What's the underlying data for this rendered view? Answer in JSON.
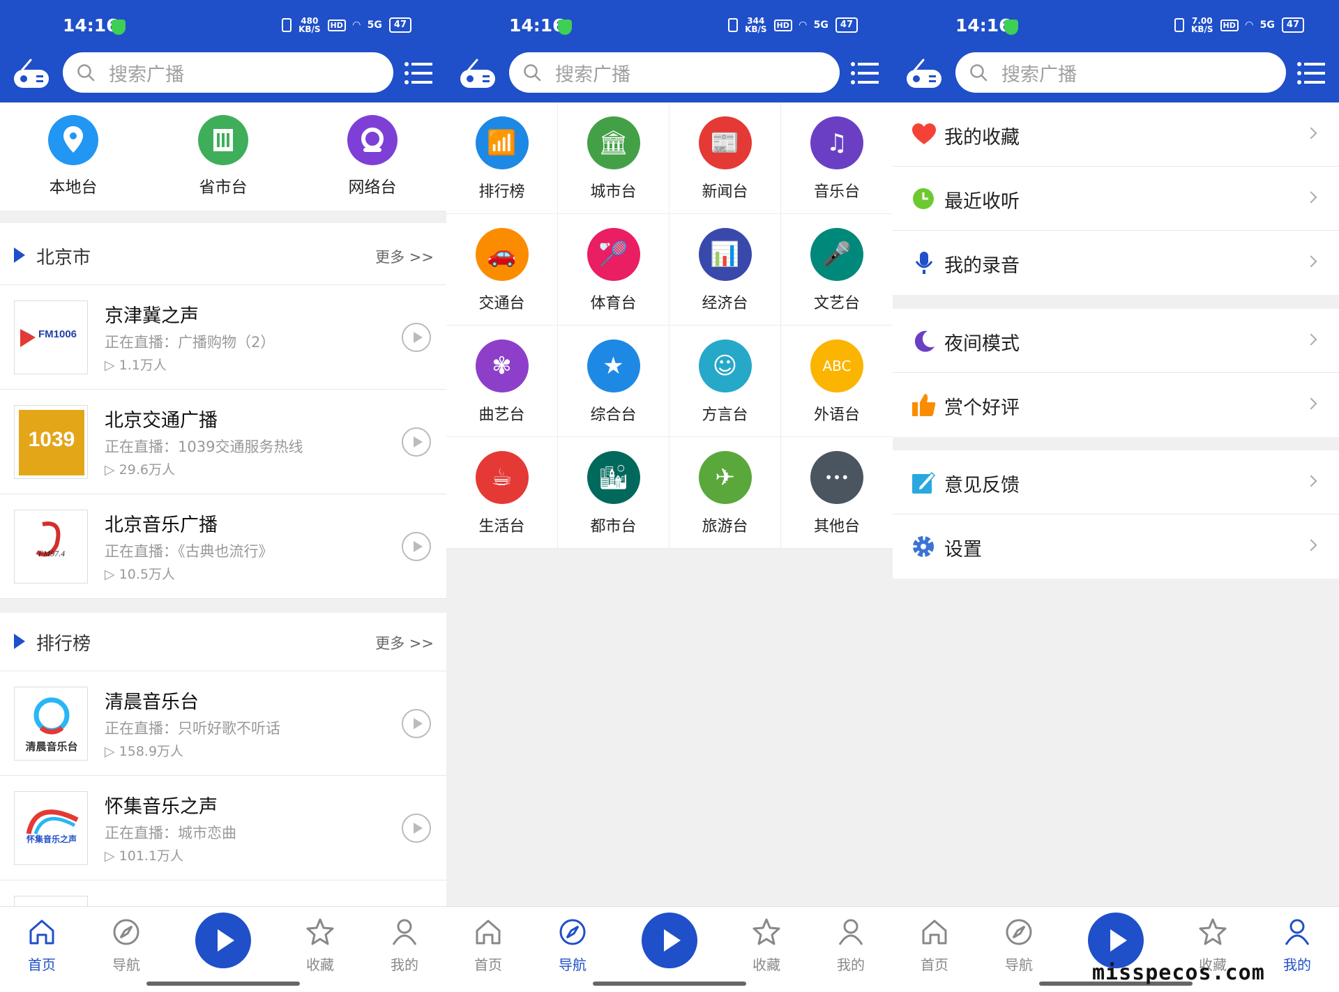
{
  "status": {
    "time": "14:16",
    "speed_1": "480\nKB/S",
    "speed_2": "344\nKB/S",
    "speed_3": "7.00\nKB/S",
    "hd": "HD",
    "network": "5G",
    "battery": "47"
  },
  "search": {
    "placeholder": "搜索广播"
  },
  "home": {
    "quick": [
      {
        "label": "本地台",
        "color": "#2196f3",
        "icon": "location-icon"
      },
      {
        "label": "省市台",
        "color": "#3fae5a",
        "icon": "building-icon"
      },
      {
        "label": "网络台",
        "color": "#7e3fd6",
        "icon": "network-icon"
      }
    ],
    "sections": [
      {
        "title": "北京市",
        "more": "更多 >>",
        "stations": [
          {
            "name": "京津冀之声",
            "live": "正在直播：广播购物（2）",
            "count": "▷ 1.1万人",
            "logo": "FM1006"
          },
          {
            "name": "北京交通广播",
            "live": "正在直播：1039交通服务热线",
            "count": "▷ 29.6万人",
            "logo": "1039"
          },
          {
            "name": "北京音乐广播",
            "live": "正在直播：《古典也流行》",
            "count": "▷ 10.5万人",
            "logo": "FM97.4"
          }
        ]
      },
      {
        "title": "排行榜",
        "more": "更多 >>",
        "stations": [
          {
            "name": "清晨音乐台",
            "live": "正在直播：只听好歌不听话",
            "count": "▷ 158.9万人",
            "logo": "清晨音乐台"
          },
          {
            "name": "怀集音乐之声",
            "live": "正在直播：城市恋曲",
            "count": "▷ 101.1万人",
            "logo": "怀集音乐之声"
          }
        ]
      }
    ]
  },
  "categories": [
    {
      "label": "排行榜",
      "color": "#1e88e5",
      "icon": "ranking-icon",
      "glyph": "📶"
    },
    {
      "label": "城市台",
      "color": "#43a047",
      "icon": "city-icon",
      "glyph": "🏛"
    },
    {
      "label": "新闻台",
      "color": "#e53935",
      "icon": "news-icon",
      "glyph": "📰"
    },
    {
      "label": "音乐台",
      "color": "#6a3fc4",
      "icon": "music-icon",
      "glyph": "♫"
    },
    {
      "label": "交通台",
      "color": "#fb8c00",
      "icon": "car-icon",
      "glyph": "🚗"
    },
    {
      "label": "体育台",
      "color": "#e91e63",
      "icon": "sports-icon",
      "glyph": "🏸"
    },
    {
      "label": "经济台",
      "color": "#3949ab",
      "icon": "chart-icon",
      "glyph": "📊"
    },
    {
      "label": "文艺台",
      "color": "#00897b",
      "icon": "microphone-icon",
      "glyph": "🎤"
    },
    {
      "label": "曲艺台",
      "color": "#8e3fc9",
      "icon": "opera-icon",
      "glyph": "✾"
    },
    {
      "label": "综合台",
      "color": "#1e88e5",
      "icon": "book-icon",
      "glyph": "★"
    },
    {
      "label": "方言台",
      "color": "#26a8c9",
      "icon": "speaker-icon",
      "glyph": "☺"
    },
    {
      "label": "外语台",
      "color": "#fbb400",
      "icon": "abc-blocks-icon",
      "glyph": "ABC"
    },
    {
      "label": "生活台",
      "color": "#e53935",
      "icon": "coffee-icon",
      "glyph": "☕"
    },
    {
      "label": "都市台",
      "color": "#00695c",
      "icon": "skyline-icon",
      "glyph": "🏙"
    },
    {
      "label": "旅游台",
      "color": "#5aa83c",
      "icon": "plane-icon",
      "glyph": "✈"
    },
    {
      "label": "其他台",
      "color": "#4a5560",
      "icon": "more-icon",
      "glyph": "•••"
    }
  ],
  "mine": {
    "groups": [
      [
        {
          "label": "我的收藏",
          "icon": "heart-icon",
          "color": "#f44336"
        },
        {
          "label": "最近收听",
          "icon": "clock-icon",
          "color": "#6cc92f"
        },
        {
          "label": "我的录音",
          "icon": "mic-icon",
          "color": "#1f4fc9"
        }
      ],
      [
        {
          "label": "夜间模式",
          "icon": "moon-icon",
          "color": "#6a3fc4"
        },
        {
          "label": "赏个好评",
          "icon": "thumbs-up-icon",
          "color": "#fb8c00"
        }
      ],
      [
        {
          "label": "意见反馈",
          "icon": "feedback-icon",
          "color": "#29a8e0"
        },
        {
          "label": "设置",
          "icon": "gear-icon",
          "color": "#3b73d6"
        }
      ]
    ]
  },
  "bottom_nav": [
    {
      "label": "首页",
      "icon": "home-icon"
    },
    {
      "label": "导航",
      "icon": "compass-icon"
    },
    {
      "label": "收藏",
      "icon": "star-icon"
    },
    {
      "label": "我的",
      "icon": "user-icon"
    }
  ],
  "watermark": "misspecos.com"
}
